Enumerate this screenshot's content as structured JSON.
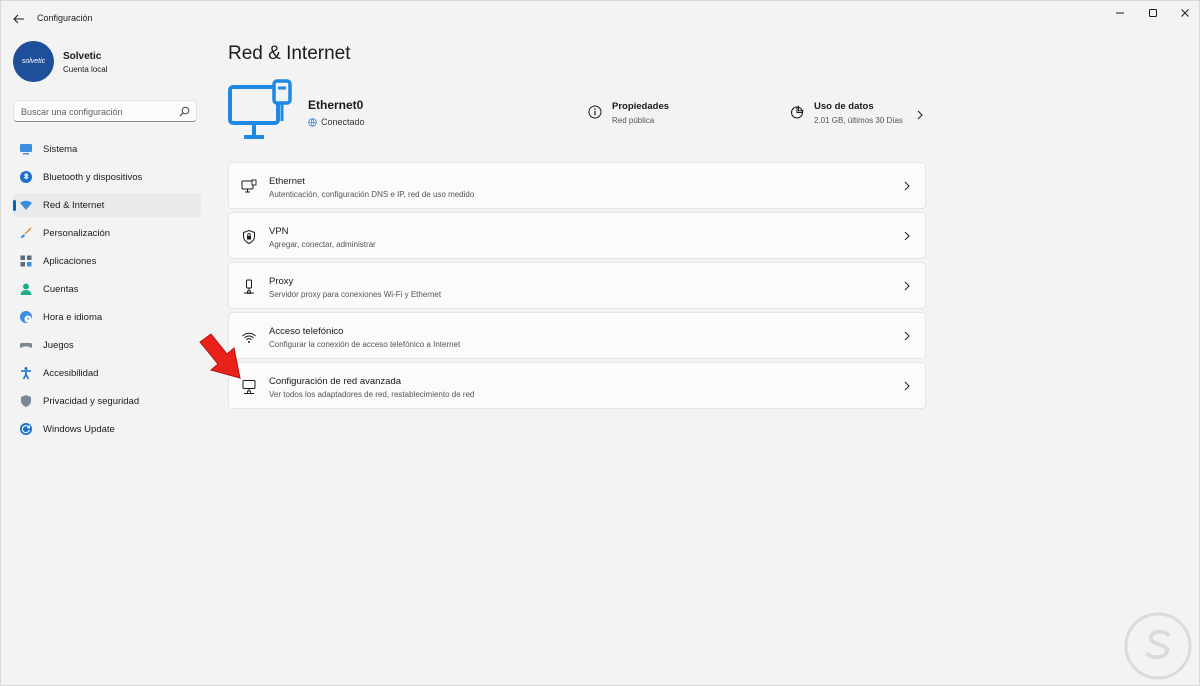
{
  "window": {
    "title": "Configuración"
  },
  "profile": {
    "name": "Solvetic",
    "account_type": "Cuenta local",
    "avatar_text": "solvetic"
  },
  "search": {
    "placeholder": "Buscar una configuración"
  },
  "nav": {
    "items": [
      {
        "label": "Sistema",
        "icon": "monitor-icon",
        "active": false
      },
      {
        "label": "Bluetooth y dispositivos",
        "icon": "bluetooth-icon",
        "active": false
      },
      {
        "label": "Red & Internet",
        "icon": "wifi-icon",
        "active": true
      },
      {
        "label": "Personalización",
        "icon": "brush-icon",
        "active": false
      },
      {
        "label": "Aplicaciones",
        "icon": "apps-icon",
        "active": false
      },
      {
        "label": "Cuentas",
        "icon": "person-icon",
        "active": false
      },
      {
        "label": "Hora e idioma",
        "icon": "globe-clock-icon",
        "active": false
      },
      {
        "label": "Juegos",
        "icon": "gamepad-icon",
        "active": false
      },
      {
        "label": "Accesibilidad",
        "icon": "accessibility-icon",
        "active": false
      },
      {
        "label": "Privacidad y seguridad",
        "icon": "shield-icon",
        "active": false
      },
      {
        "label": "Windows Update",
        "icon": "update-icon",
        "active": false
      }
    ]
  },
  "page": {
    "title": "Red & Internet"
  },
  "hero": {
    "connection_name": "Ethernet0",
    "connection_status": "Conectado",
    "properties_title": "Propiedades",
    "properties_sub": "Red pública",
    "data_title": "Uso de datos",
    "data_sub": "2.01 GB, últimos 30 Días"
  },
  "cards": [
    {
      "title": "Ethernet",
      "subtitle": "Autenticación, configuración DNS e IP, red de uso medido",
      "icon": "ethernet-monitor-icon"
    },
    {
      "title": "VPN",
      "subtitle": "Agregar, conectar, administrar",
      "icon": "vpn-shield-icon"
    },
    {
      "title": "Proxy",
      "subtitle": "Servidor proxy para conexiones Wi-Fi y Ethernet",
      "icon": "proxy-icon"
    },
    {
      "title": "Acceso telefónico",
      "subtitle": "Configurar la conexión de acceso telefónico a Internet",
      "icon": "dialup-icon"
    },
    {
      "title": "Configuración de red avanzada",
      "subtitle": "Ver todos los adaptadores de red, restablecimiento de red",
      "icon": "network-adapter-icon"
    }
  ],
  "colors": {
    "accent": "#0067c0",
    "window_bg": "#f3f3f3",
    "card_bg": "#fbfbfb",
    "annotation_arrow": "#e8211b"
  }
}
